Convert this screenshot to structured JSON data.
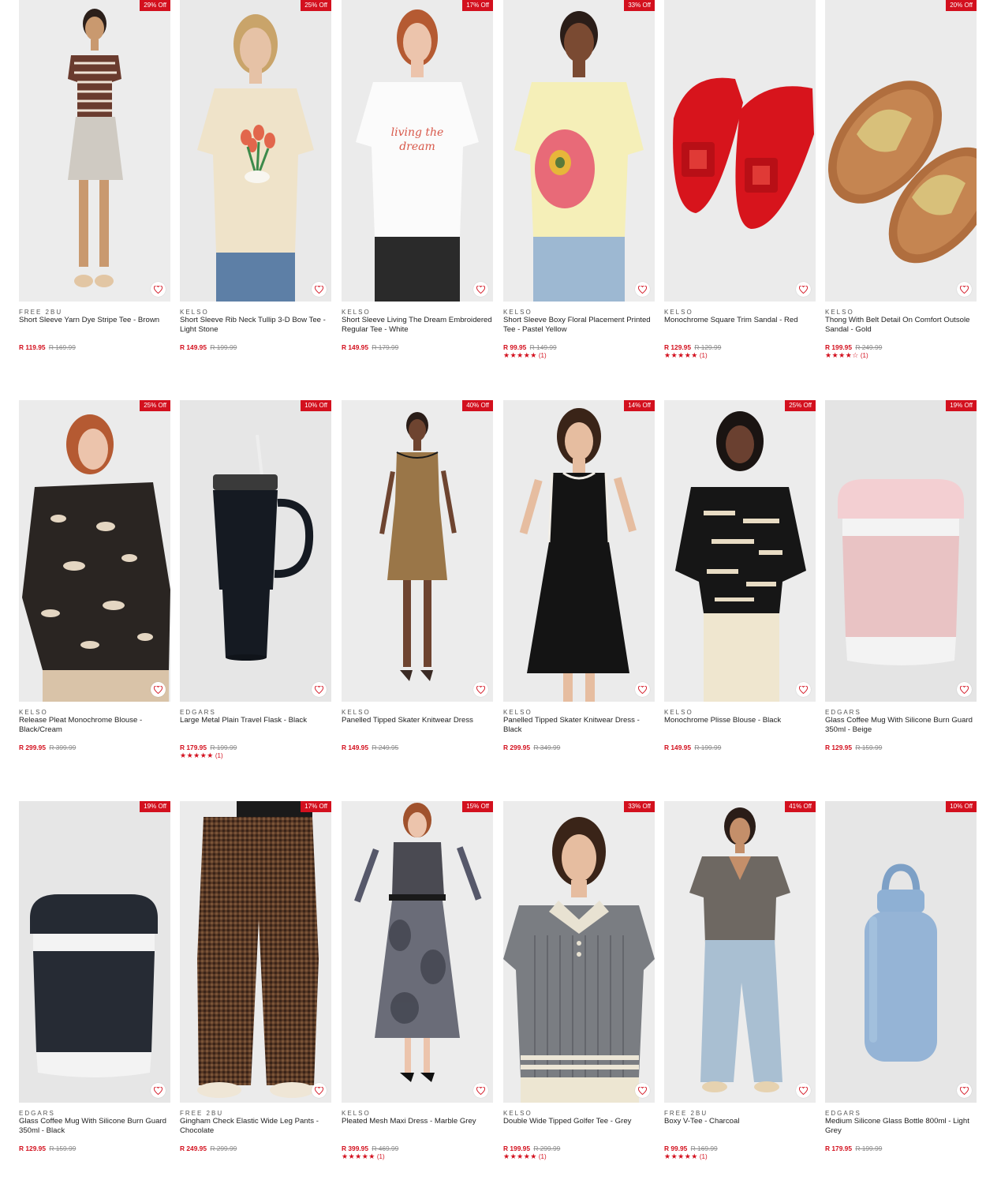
{
  "colors": {
    "accent": "#d3101e",
    "badge_text": "#ffffff"
  },
  "wishlist_icon": "heart-outline-icon",
  "rows": [
    {
      "products": [
        {
          "badge": "29% Off",
          "brand": "FREE 2BU",
          "title": "Short Sleeve Yarn Dye Stripe Tee - Brown",
          "price": "R 119.95",
          "was": "R 169.99",
          "stars": "",
          "reviews": ""
        },
        {
          "badge": "25% Off",
          "brand": "KELSO",
          "title": "Short Sleeve Rib Neck Tullip 3-D Bow Tee - Light Stone",
          "price": "R 149.95",
          "was": "R 199.99",
          "stars": "",
          "reviews": ""
        },
        {
          "badge": "17% Off",
          "brand": "KELSO",
          "title": "Short Sleeve Living The Dream Embroidered Regular Tee - White",
          "price": "R 149.95",
          "was": "R 179.99",
          "stars": "",
          "reviews": ""
        },
        {
          "badge": "33% Off",
          "brand": "KELSO",
          "title": "Short Sleeve Boxy Floral Placement Printed Tee - Pastel Yellow",
          "price": "R 99.95",
          "was": "R 149.99",
          "stars": "★★★★★",
          "reviews": "(1)"
        },
        {
          "badge": "",
          "brand": "KELSO",
          "title": "Monochrome Square Trim Sandal - Red",
          "price": "R 129.95",
          "was": "R 129.99",
          "stars": "★★★★★",
          "reviews": "(1)"
        },
        {
          "badge": "20% Off",
          "brand": "KELSO",
          "title": "Thong With Belt Detail On Comfort Outsole Sandal - Gold",
          "price": "R 199.95",
          "was": "R 249.99",
          "stars": "★★★★☆",
          "reviews": "(1)"
        }
      ]
    },
    {
      "products": [
        {
          "badge": "25% Off",
          "brand": "KELSO",
          "title": "Release Pleat Monochrome Blouse - Black/Cream",
          "price": "R 299.95",
          "was": "R 399.99",
          "stars": "",
          "reviews": ""
        },
        {
          "badge": "10% Off",
          "brand": "EDGARS",
          "title": "Large Metal Plain Travel Flask - Black",
          "price": "R 179.95",
          "was": "R 199.99",
          "stars": "★★★★★",
          "reviews": "(1)"
        },
        {
          "badge": "40% Off",
          "brand": "KELSO",
          "title": "Panelled Tipped Skater Knitwear Dress",
          "price": "R 149.95",
          "was": "R 249.95",
          "stars": "",
          "reviews": ""
        },
        {
          "badge": "14% Off",
          "brand": "KELSO",
          "title": "Panelled Tipped Skater Knitwear Dress - Black",
          "price": "R 299.95",
          "was": "R 349.99",
          "stars": "",
          "reviews": ""
        },
        {
          "badge": "25% Off",
          "brand": "KELSO",
          "title": "Monochrome Plisse Blouse - Black",
          "price": "R 149.95",
          "was": "R 199.99",
          "stars": "",
          "reviews": ""
        },
        {
          "badge": "19% Off",
          "brand": "EDGARS",
          "title": "Glass Coffee Mug With Silicone Burn Guard 350ml - Beige",
          "price": "R 129.95",
          "was": "R 159.99",
          "stars": "",
          "reviews": ""
        }
      ]
    },
    {
      "products": [
        {
          "badge": "19% Off",
          "brand": "EDGARS",
          "title": "Glass Coffee Mug With Silicone Burn Guard 350ml - Black",
          "price": "R 129.95",
          "was": "R 159.99",
          "stars": "",
          "reviews": ""
        },
        {
          "badge": "17% Off",
          "brand": "FREE 2BU",
          "title": "Gingham Check Elastic Wide Leg Pants - Chocolate",
          "price": "R 249.95",
          "was": "R 299.99",
          "stars": "",
          "reviews": ""
        },
        {
          "badge": "15% Off",
          "brand": "KELSO",
          "title": "Pleated Mesh Maxi Dress - Marble Grey",
          "price": "R 399.95",
          "was": "R 469.99",
          "stars": "★★★★★",
          "reviews": "(1)"
        },
        {
          "badge": "33% Off",
          "brand": "KELSO",
          "title": "Double Wide Tipped Golfer Tee - Grey",
          "price": "R 199.95",
          "was": "R 299.99",
          "stars": "★★★★★",
          "reviews": "(1)"
        },
        {
          "badge": "41% Off",
          "brand": "FREE 2BU",
          "title": "Boxy V-Tee - Charcoal",
          "price": "R 99.95",
          "was": "R 169.99",
          "stars": "★★★★★",
          "reviews": "(1)"
        },
        {
          "badge": "10% Off",
          "brand": "EDGARS",
          "title": "Medium Silicone Glass Bottle 800ml - Light Grey",
          "price": "R 179.95",
          "was": "R 199.99",
          "stars": "",
          "reviews": ""
        }
      ]
    }
  ]
}
